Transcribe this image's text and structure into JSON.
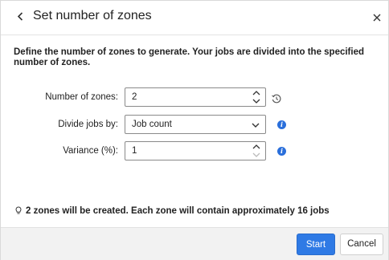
{
  "dialog": {
    "title": "Set number of zones",
    "description": "Define the number of zones to generate. Your jobs are divided into the specified number of zones."
  },
  "form": {
    "zones": {
      "label": "Number of zones:",
      "value": "2"
    },
    "divide": {
      "label": "Divide jobs by:",
      "value": "Job count"
    },
    "variance": {
      "label": "Variance (%):",
      "value": "1"
    }
  },
  "note": "2 zones will be created. Each zone will contain approximately 16 jobs",
  "footer": {
    "start_label": "Start",
    "cancel_label": "Cancel"
  },
  "colors": {
    "accent": "#2f7ae5",
    "info": "#2a6fdb",
    "footer_bg": "#f2f2f2"
  },
  "icons": [
    "chevron-left-icon",
    "close-icon",
    "spin-up-icon",
    "spin-down-icon",
    "history-icon",
    "chevron-down-icon",
    "info-icon",
    "lightbulb-icon"
  ]
}
